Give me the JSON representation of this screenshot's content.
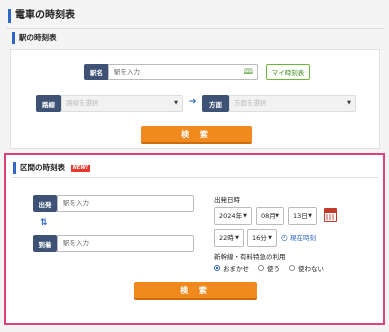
{
  "page_title": "電車の時刻表",
  "station_section": {
    "heading": "駅の時刻表",
    "station_label": "駅名",
    "station_placeholder": "駅を入力",
    "my_timetable_button": "マイ時刻表",
    "line_label": "路線",
    "line_placeholder": "路線を選択",
    "direction_label": "方面",
    "direction_placeholder": "方面を選択",
    "search_button": "検 索"
  },
  "route_section": {
    "heading": "区間の時刻表",
    "new_badge": "NEW!",
    "departure_label": "出発",
    "departure_placeholder": "駅を入力",
    "arrival_label": "到着",
    "arrival_placeholder": "駅を入力",
    "datetime_heading": "出発日時",
    "year_value": "2024年",
    "month_value": "08月",
    "day_value": "13日",
    "hour_value": "22時",
    "minute_value": "16分",
    "current_time_link": "現在時刻",
    "express_heading": "新幹線・有料特急の利用",
    "options": [
      "おまかせ",
      "使う",
      "使わない"
    ],
    "selected_option": "おまかせ",
    "search_button": "検 索"
  },
  "colors": {
    "accent": "#2e68c2",
    "label_bg": "#3d5275",
    "button": "#f0891e",
    "highlight_border": "#e0407b",
    "badge": "#e8382c"
  }
}
